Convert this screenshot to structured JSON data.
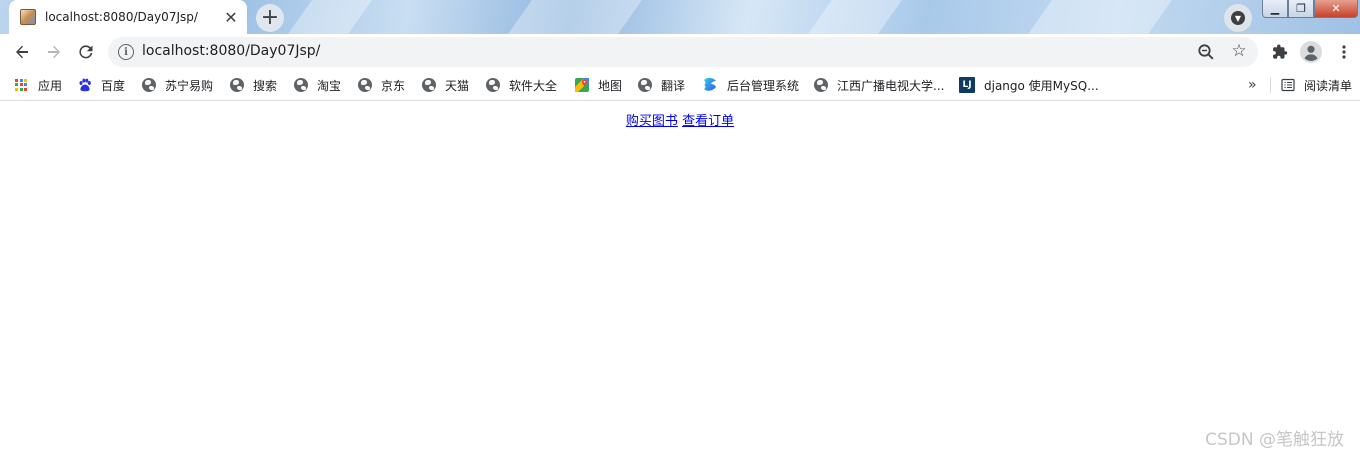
{
  "tab": {
    "title": "localhost:8080/Day07Jsp/",
    "close_glyph": "✕",
    "new_tab_glyph": "+"
  },
  "window": {
    "minimize_glyph": "▁",
    "maximize_glyph": "❐",
    "close_glyph": "✕"
  },
  "toolbar": {
    "url": "localhost:8080/Day07Jsp/",
    "info_glyph": "i",
    "star_glyph": "☆"
  },
  "bookmarks": {
    "apps_label": "应用",
    "items": [
      {
        "label": "百度",
        "icon": "baidu-icon"
      },
      {
        "label": "苏宁易购",
        "icon": "globe-icon"
      },
      {
        "label": "搜索",
        "icon": "globe-icon"
      },
      {
        "label": "淘宝",
        "icon": "globe-icon"
      },
      {
        "label": "京东",
        "icon": "globe-icon"
      },
      {
        "label": "天猫",
        "icon": "globe-icon"
      },
      {
        "label": "软件大全",
        "icon": "globe-icon"
      },
      {
        "label": "地图",
        "icon": "maps-icon"
      },
      {
        "label": "翻译",
        "icon": "globe-icon"
      },
      {
        "label": "后台管理系统",
        "icon": "admin-icon"
      },
      {
        "label": "江西广播电视大学...",
        "icon": "globe-icon"
      },
      {
        "label": "django 使用MySQ...",
        "icon": "lj-icon"
      }
    ],
    "lj_badge": "LJ",
    "overflow_glyph": "»",
    "reading_list_label": "阅读清单"
  },
  "page": {
    "link_buy": "购买图书",
    "link_orders": "查看订单"
  },
  "watermark": "CSDN @笔触狂放",
  "colors": {
    "link": "#0000ee",
    "chrome_blue": "#1a73e8",
    "omnibox_bg": "#f1f3f4"
  }
}
